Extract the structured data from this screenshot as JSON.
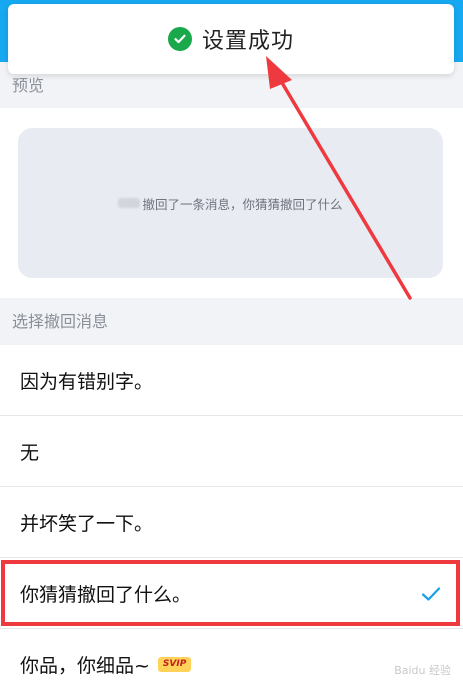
{
  "toast": {
    "text": "设置成功"
  },
  "preview": {
    "header": "预览",
    "message": "撤回了一条消息，你猜猜撤回了什么"
  },
  "options_section": {
    "header": "选择撤回消息"
  },
  "options": [
    {
      "label": "因为有错别字。"
    },
    {
      "label": "无"
    },
    {
      "label": "并坏笑了一下。"
    },
    {
      "label": "你猜猜撤回了什么。",
      "selected": true
    },
    {
      "label": "你品，你细品~",
      "badge": "SVIP"
    }
  ],
  "watermark": "Baidu 经验",
  "colors": {
    "accent_blue": "#16a8f0",
    "success_green": "#19a84a",
    "highlight_red": "#ee3a3e",
    "check_blue": "#1aa0e8"
  }
}
